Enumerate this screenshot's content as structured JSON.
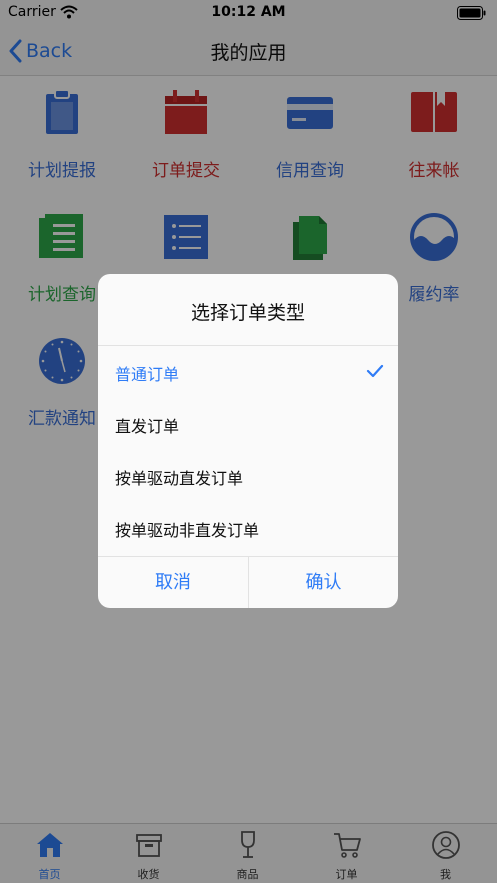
{
  "status_bar": {
    "carrier": "Carrier",
    "time": "10:12 AM"
  },
  "nav": {
    "back_label": "Back",
    "title": "我的应用"
  },
  "apps": [
    {
      "label": "计划提报",
      "color": "#3a6fd8",
      "icon": "clipboard-icon"
    },
    {
      "label": "订单提交",
      "color": "#d03030",
      "icon": "calendar-icon"
    },
    {
      "label": "信用查询",
      "color": "#3a6fd8",
      "icon": "credit-card-icon"
    },
    {
      "label": "往来帐",
      "color": "#d03030",
      "icon": "book-icon"
    },
    {
      "label": "计划查询",
      "color": "#2ea84a",
      "icon": "document-list-icon"
    },
    {
      "label": "",
      "color": "#3a6fd8",
      "icon": "list-icon"
    },
    {
      "label": "",
      "color": "#2ea84a",
      "icon": "files-icon"
    },
    {
      "label": "履约率",
      "color": "#3a6fd8",
      "icon": "wave-icon"
    },
    {
      "label": "汇款通知",
      "color": "#3a6fd8",
      "icon": "clock-icon"
    }
  ],
  "dialog": {
    "title": "选择订单类型",
    "options": [
      {
        "label": "普通订单",
        "selected": true
      },
      {
        "label": "直发订单",
        "selected": false
      },
      {
        "label": "按单驱动直发订单",
        "selected": false
      },
      {
        "label": "按单驱动非直发订单",
        "selected": false
      }
    ],
    "cancel_label": "取消",
    "confirm_label": "确认"
  },
  "tabs": [
    {
      "label": "首页",
      "icon": "home-icon",
      "active": true
    },
    {
      "label": "收货",
      "icon": "box-icon",
      "active": false
    },
    {
      "label": "商品",
      "icon": "wine-glass-icon",
      "active": false
    },
    {
      "label": "订单",
      "icon": "cart-icon",
      "active": false
    },
    {
      "label": "我",
      "icon": "user-icon",
      "active": false
    }
  ],
  "colors": {
    "accent": "#2f7cf6",
    "blue": "#3a6fd8",
    "red": "#d03030",
    "green": "#2ea84a"
  }
}
